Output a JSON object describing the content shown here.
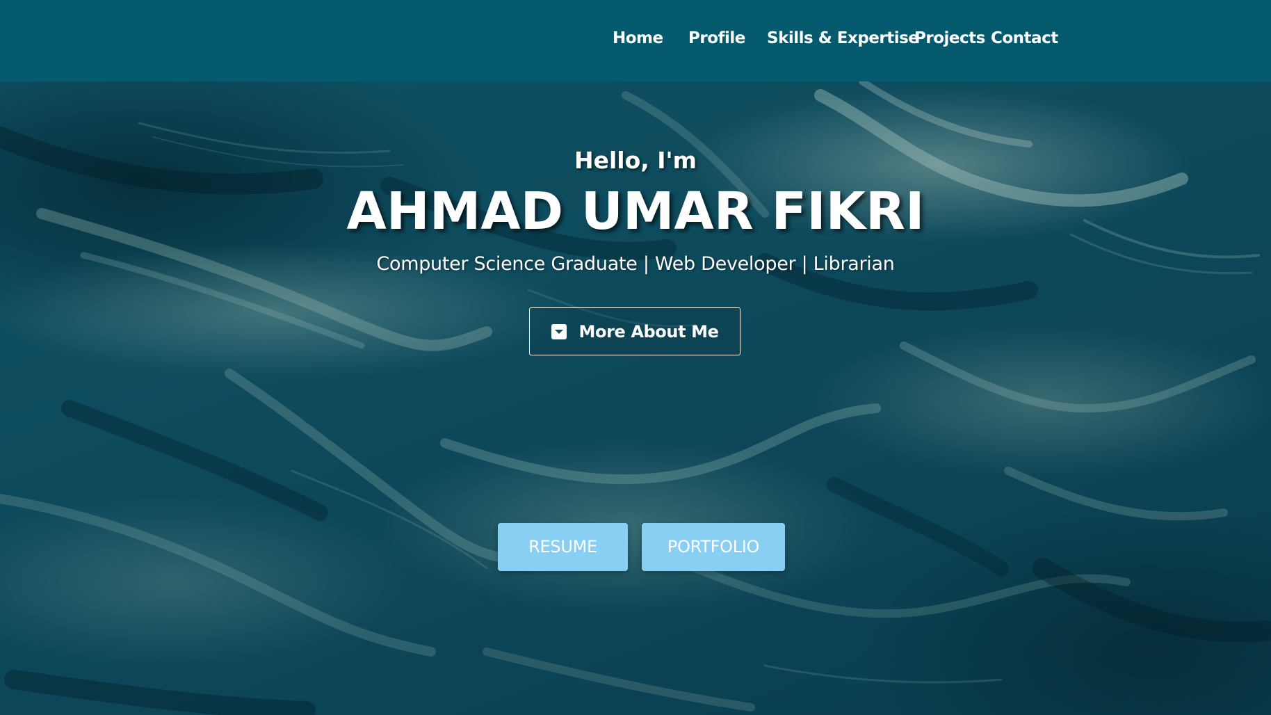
{
  "nav": {
    "items": [
      {
        "label": "Home"
      },
      {
        "label": "Profile"
      },
      {
        "label": "Skills & Expertise"
      },
      {
        "label": "Projects"
      },
      {
        "label": "Contact"
      }
    ]
  },
  "hero": {
    "greeting": "Hello, I'm",
    "name": "AHMAD UMAR FIKRI",
    "tagline": "Computer Science Graduate | Web Developer | Librarian",
    "more_button": {
      "label": "More About Me",
      "icon": "chevron-down-square-icon"
    },
    "resume_button": {
      "label": "RESUME"
    },
    "portfolio_button": {
      "label": "PORTFOLIO"
    }
  },
  "colors": {
    "navbar": "#055a6e",
    "cta_button": "#89cff4",
    "text": "#ffffff",
    "background_ocean": "#0d4a5c"
  }
}
